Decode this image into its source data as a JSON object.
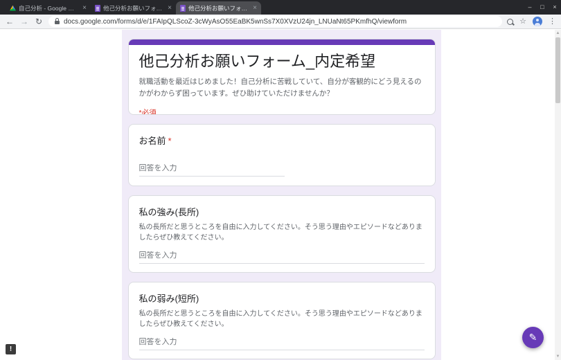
{
  "browser": {
    "tabs": [
      {
        "label": "自己分析 - Google ドライブ"
      },
      {
        "label": "他己分析お願いフォーム_内定希望"
      },
      {
        "label": "他己分析お願いフォーム_内定希望"
      }
    ],
    "url": "docs.google.com/forms/d/e/1FAIpQLScoZ-3cWyAsO55EaBK5wnSs7X0XVzU24jn_LNUaNt65PKmfhQ/viewform"
  },
  "icons": {
    "back": "←",
    "forward": "→",
    "reload": "↻",
    "close_tab": "×",
    "minimize": "–",
    "maximize": "□",
    "close_window": "×",
    "star": "☆",
    "menu": "⋮",
    "pencil": "✎",
    "alert": "!",
    "scroll_up": "▲",
    "scroll_down": "▼"
  },
  "form": {
    "title": "他己分析お願いフォーム_内定希望",
    "description": "就職活動を最近はじめました！自己分析に苦戦していて、自分が客観的にどう見えるのかがわからず困っています。ぜひ助けていただけませんか？",
    "required_note": "*必須",
    "required_mark": "*",
    "questions": [
      {
        "label": "お名前",
        "placeholder": "回答を入力"
      },
      {
        "label": "私の強み(長所)",
        "description": "私の長所だと思うところを自由に入力してください。そう思う理由やエピソードなどありましたらぜひ教えてください。",
        "placeholder": "回答を入力"
      },
      {
        "label": "私の弱み(短所)",
        "description": "私の長所だと思うところを自由に入力してください。そう思う理由やエピソードなどありましたらぜひ教えてください。",
        "placeholder": "回答を入力"
      }
    ]
  },
  "colors": {
    "theme": "#673ab7",
    "page_background": "#f0ebf8",
    "required": "#d93025"
  }
}
